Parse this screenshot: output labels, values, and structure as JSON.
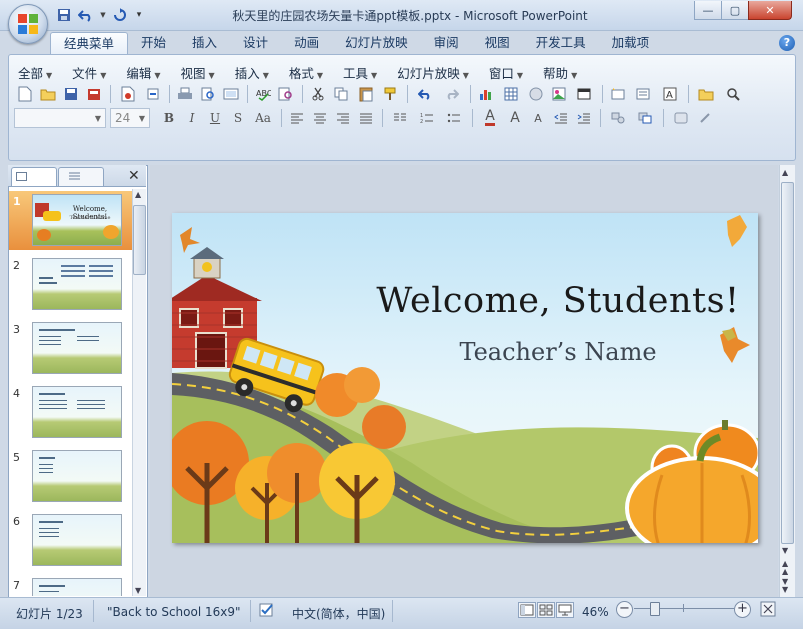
{
  "window": {
    "title": "秋天里的庄园农场矢量卡通ppt模板.pptx - Microsoft PowerPoint",
    "buttons": {
      "minimize": "—",
      "maximize": "▢",
      "close": "✕"
    }
  },
  "ribbon_tabs": [
    "经典菜单",
    "开始",
    "插入",
    "设计",
    "动画",
    "幻灯片放映",
    "审阅",
    "视图",
    "开发工具",
    "加载项"
  ],
  "active_tab": "经典菜单",
  "classic_menu": [
    "全部",
    "文件",
    "编辑",
    "视图",
    "插入",
    "格式",
    "工具",
    "幻灯片放映",
    "窗口",
    "帮助"
  ],
  "font_box": {
    "font_name": "",
    "font_size": "24"
  },
  "format_buttons": [
    "B",
    "I",
    "U",
    "S",
    "Aa"
  ],
  "slides": [
    {
      "num": "1",
      "title": "Welcome, Students!",
      "subtitle": "Teacher's Name"
    },
    {
      "num": "2"
    },
    {
      "num": "3"
    },
    {
      "num": "4"
    },
    {
      "num": "5"
    },
    {
      "num": "6"
    },
    {
      "num": "7"
    }
  ],
  "current_slide": {
    "title": "Welcome, Students!",
    "subtitle": "Teacher’s Name"
  },
  "status": {
    "slide_counter": "幻灯片 1/23",
    "theme": "\"Back to School 16x9\"",
    "language": "中文(简体，中国)",
    "zoom": "46%"
  },
  "colors": {
    "accent": "#2b5797",
    "selected_thumb": "#f0a34a",
    "slide_sky": "#bfe3f6",
    "hill": "#a9c15c",
    "barn": "#c0392b",
    "pumpkin": "#f3a02b"
  }
}
